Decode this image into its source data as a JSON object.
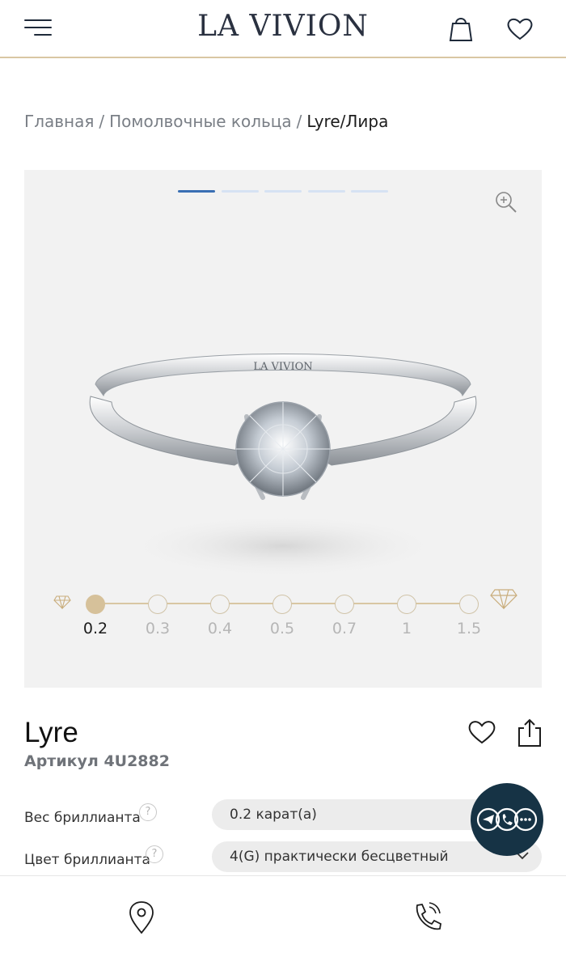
{
  "header": {
    "logo": "LA VIVION",
    "menu_icon": "menu-icon",
    "cart_icon": "shopping-bag-icon",
    "favorites_icon": "heart-icon"
  },
  "breadcrumb": {
    "items": [
      "Главная",
      "Помолвочные кольца",
      "Lyre/Лира"
    ],
    "separator": "/"
  },
  "gallery": {
    "slides": 5,
    "active_slide": 1,
    "zoom_icon": "zoom-in-icon",
    "engraving": "LA VIVION",
    "carat_options": [
      "0.2",
      "0.3",
      "0.4",
      "0.5",
      "0.7",
      "1",
      "1.5"
    ],
    "selected_carat": "0.2"
  },
  "product": {
    "title": "Lyre",
    "sku": "Артикул 4U2882",
    "favorite_icon": "heart-outline-icon",
    "share_icon": "share-icon"
  },
  "options": [
    {
      "label": "Вес бриллианта",
      "value": "0.2 карат(а)"
    },
    {
      "label": "Цвет бриллианта",
      "value": "4(G) практически бесцветный"
    }
  ],
  "chat": {
    "icon": "messenger-icons"
  },
  "bottom_bar": {
    "location_icon": "location-pin-icon",
    "phone_icon": "phone-icon"
  },
  "colors": {
    "accent_gold": "#d6c19a",
    "navy": "#163345",
    "active_dot": "#3a6fb3"
  }
}
